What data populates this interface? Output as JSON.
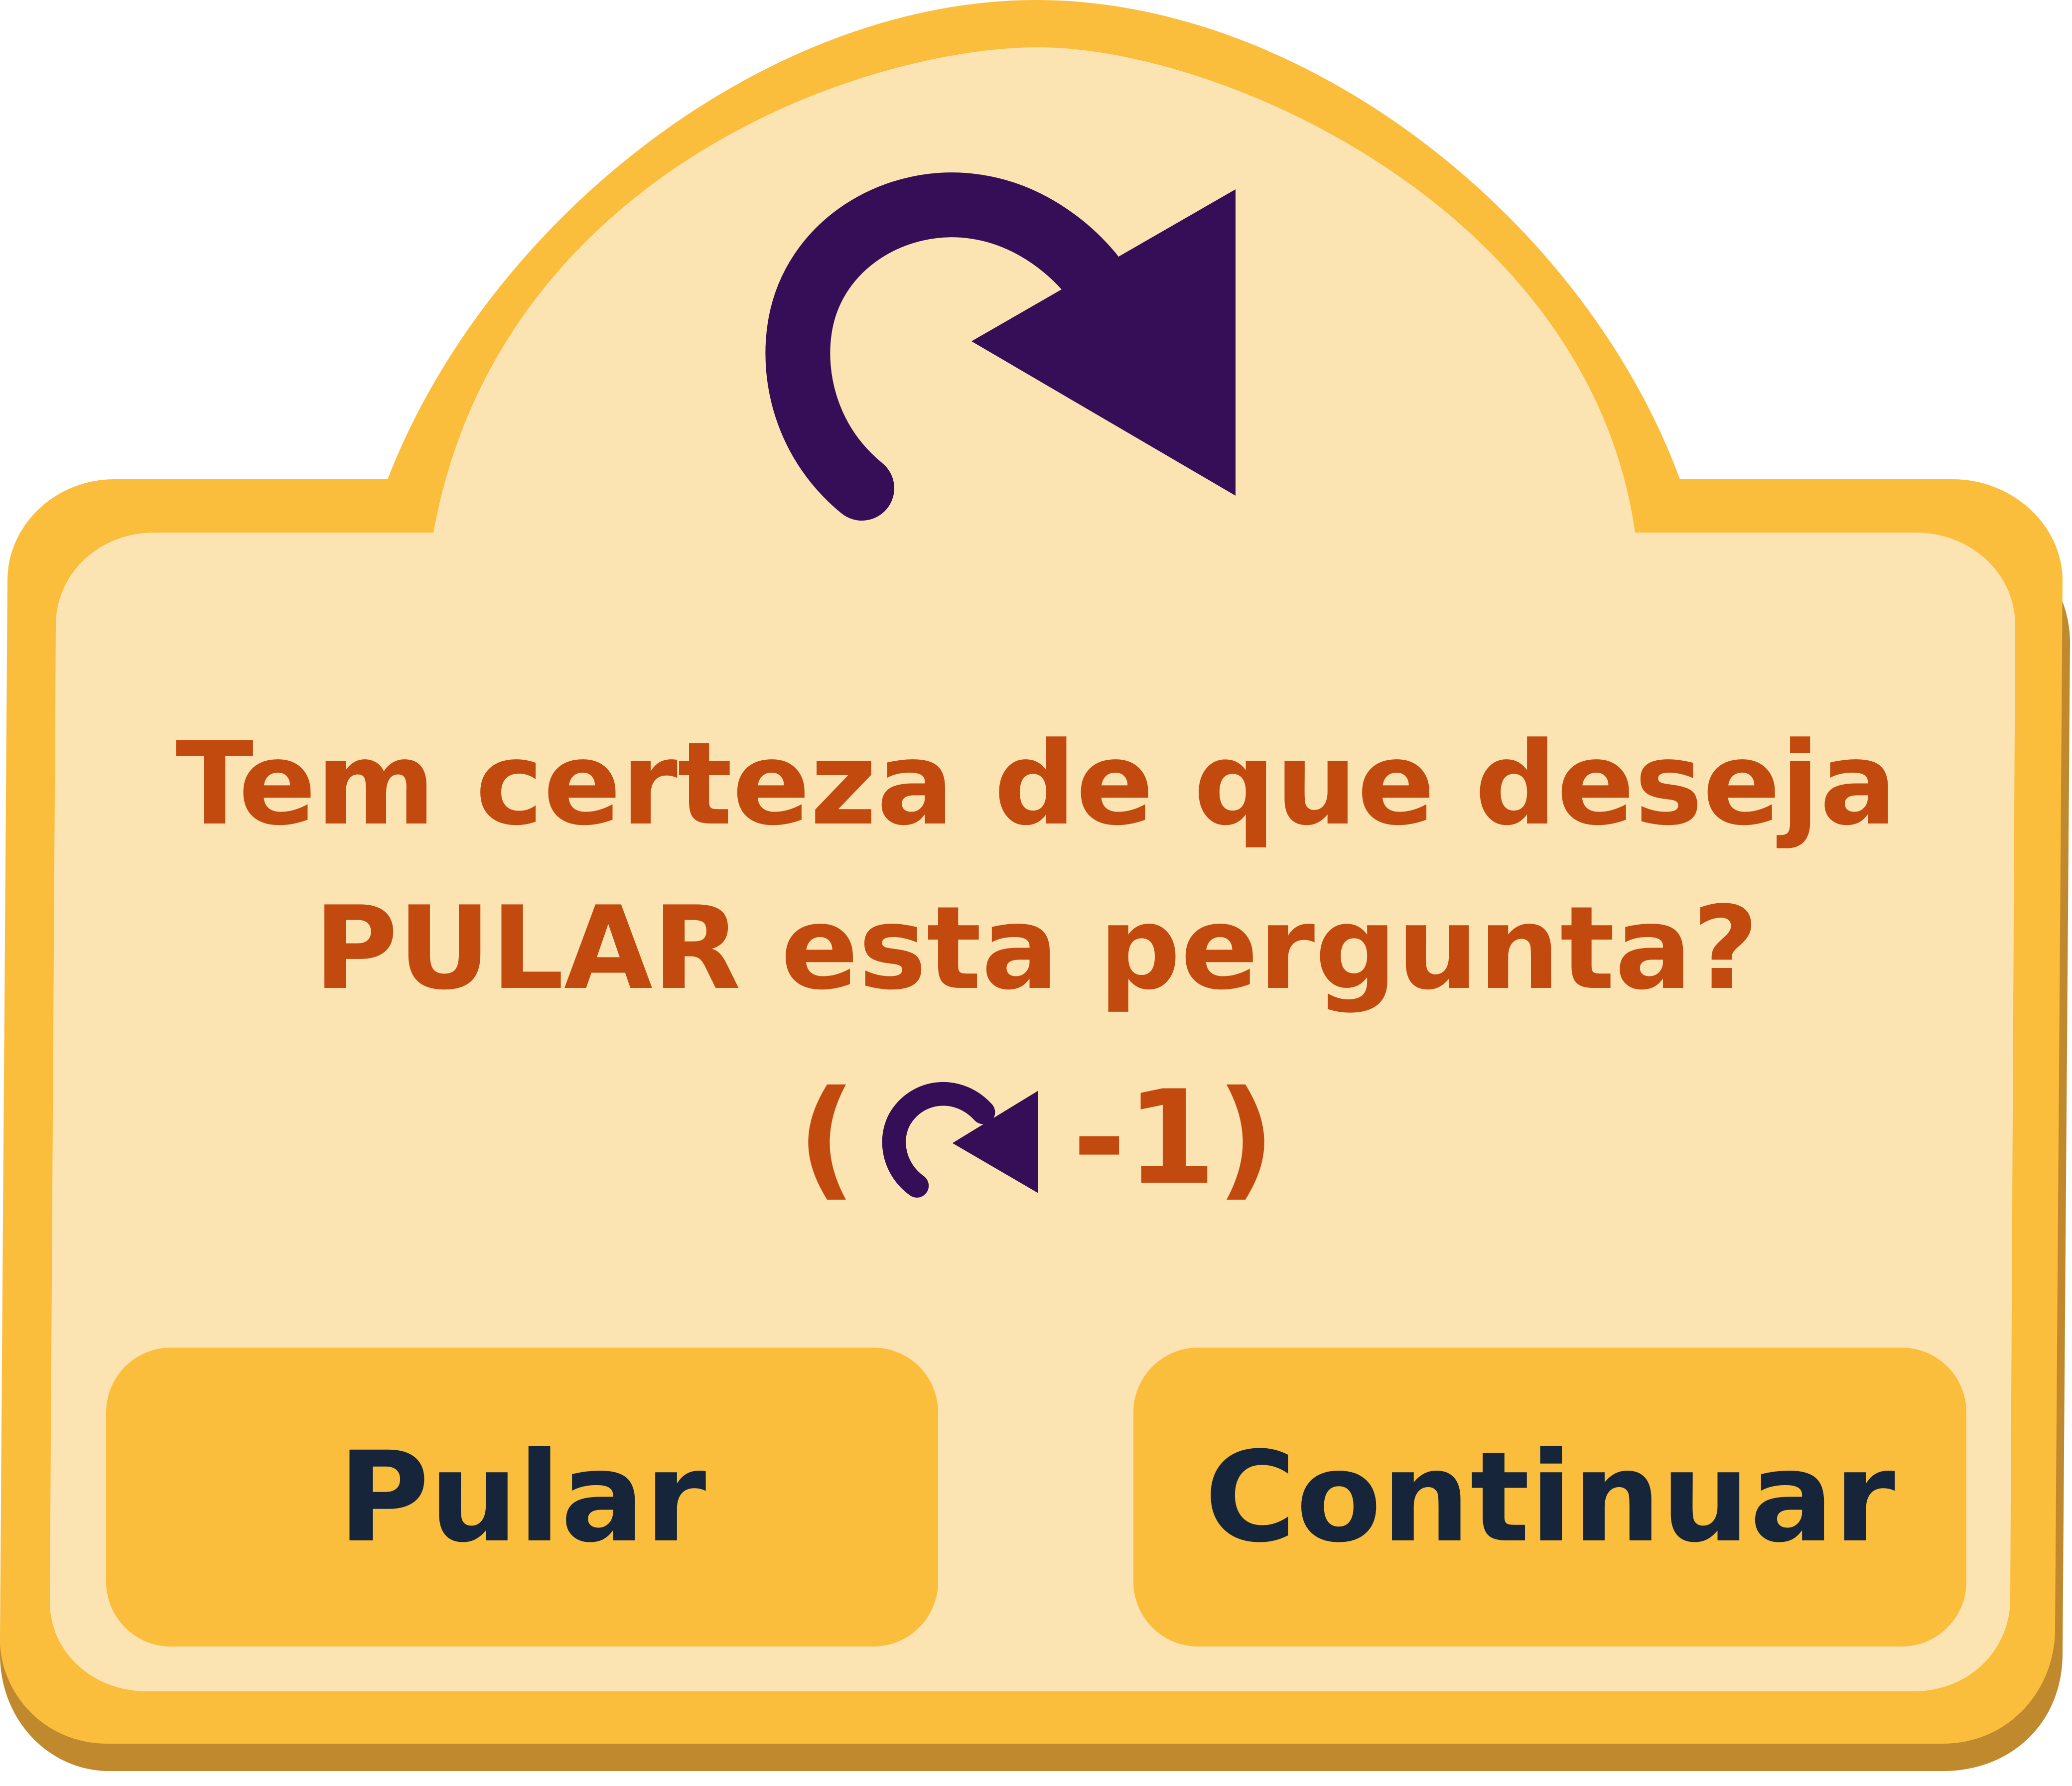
{
  "dialog": {
    "question": "Tem certeza de que deseja PULAR esta pergunta?",
    "cost_open": "(",
    "cost_value": "-1)",
    "cost_icon": "skip-redo-arrow-icon",
    "header_icon": "skip-redo-arrow-icon"
  },
  "buttons": {
    "skip_label": "Pular",
    "continue_label": "Continuar"
  },
  "colors": {
    "frame_outer": "#fbbe3c",
    "frame_shadow": "#c1892e",
    "panel": "#fce3b2",
    "text": "#c24a0e",
    "icon": "#360e58",
    "button": "#fbbe3c",
    "button_text": "#16253a"
  }
}
